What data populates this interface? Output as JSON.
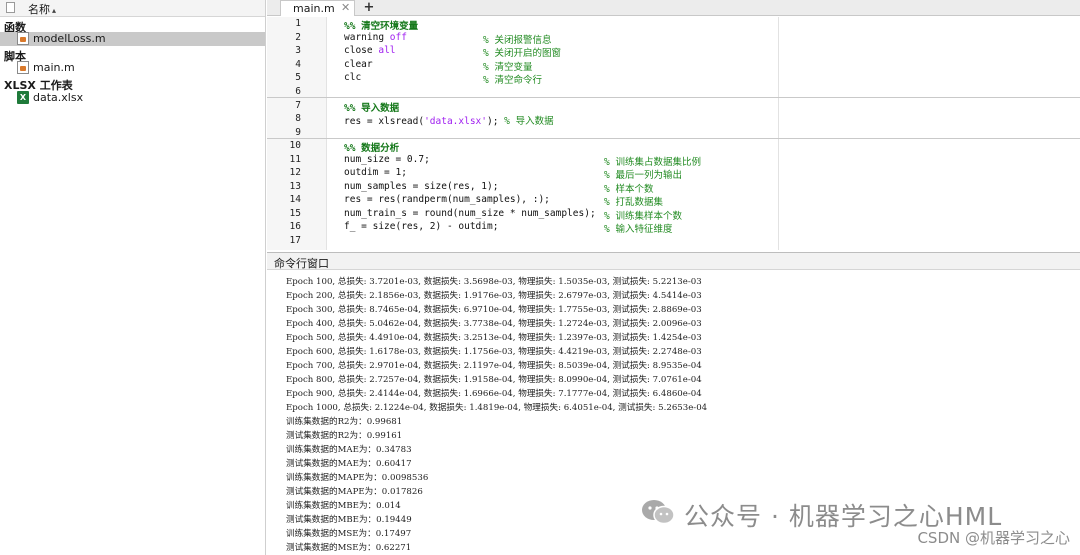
{
  "sidebar": {
    "column_header": "名称",
    "groups": {
      "functions": "函数",
      "scripts": "脚本",
      "xlsx": "XLSX 工作表"
    },
    "files": {
      "modelloss": "modelLoss.m",
      "main": "main.m",
      "data": "data.xlsx"
    }
  },
  "editor": {
    "tab_label": "main.m",
    "line_numbers": [
      "1",
      "2",
      "3",
      "4",
      "5",
      "6",
      "7",
      "8",
      "9",
      "10",
      "11",
      "12",
      "13",
      "14",
      "15",
      "16",
      "17"
    ],
    "code": {
      "l1_title": "%% 清空环境变量",
      "l2_cmd": "warning",
      "l2_kw": "off",
      "l2_cmt": "% 关闭报警信息",
      "l3_cmd": "close",
      "l3_kw": "all",
      "l3_cmt": "% 关闭开启的图窗",
      "l4_cmd": "clear",
      "l4_cmt": "% 清空变量",
      "l5_cmd": "clc",
      "l5_cmt": "% 清空命令行",
      "l7_title": "%% 导入数据",
      "l8_pre": "res = xlsread(",
      "l8_str": "'data.xlsx'",
      "l8_post": "); ",
      "l8_cmt": "% 导入数据",
      "l10_title": "%% 数据分析",
      "l11_code": "num_size = 0.7;",
      "l11_cmt": "% 训练集占数据集比例",
      "l12_code": "outdim = 1;",
      "l12_cmt": "% 最后一列为输出",
      "l13_code": "num_samples = size(res, 1);",
      "l13_cmt": "% 样本个数",
      "l14_code": "res = res(randperm(num_samples), :);",
      "l14_cmt": "% 打乱数据集",
      "l15_code": "num_train_s = round(num_size * num_samples);",
      "l15_cmt": "% 训练集样本个数",
      "l16_code": "f_ = size(res, 2) - outdim;",
      "l16_cmt": "% 输入特征维度"
    }
  },
  "command_window": {
    "title": "命令行窗口",
    "lines": [
      "Epoch 100, 总损失: 3.7201e-03, 数据损失: 3.5698e-03, 物理损失: 1.5035e-03, 测试损失: 5.2213e-03",
      "Epoch 200, 总损失: 2.1856e-03, 数据损失: 1.9176e-03, 物理损失: 2.6797e-03, 测试损失: 4.5414e-03",
      "Epoch 300, 总损失: 8.7465e-04, 数据损失: 6.9710e-04, 物理损失: 1.7755e-03, 测试损失: 2.8869e-03",
      "Epoch 400, 总损失: 5.0462e-04, 数据损失: 3.7738e-04, 物理损失: 1.2724e-03, 测试损失: 2.0096e-03",
      "Epoch 500, 总损失: 4.4910e-04, 数据损失: 3.2513e-04, 物理损失: 1.2397e-03, 测试损失: 1.4254e-03",
      "Epoch 600, 总损失: 1.6178e-03, 数据损失: 1.1756e-03, 物理损失: 4.4219e-03, 测试损失: 2.2748e-03",
      "Epoch 700, 总损失: 2.9701e-04, 数据损失: 2.1197e-04, 物理损失: 8.5039e-04, 测试损失: 8.9535e-04",
      "Epoch 800, 总损失: 2.7257e-04, 数据损失: 1.9158e-04, 物理损失: 8.0990e-04, 测试损失: 7.0761e-04",
      "Epoch 900, 总损失: 2.4144e-04, 数据损失: 1.6966e-04, 物理损失: 7.1777e-04, 测试损失: 6.4860e-04",
      "Epoch 1000, 总损失: 2.1224e-04, 数据损失: 1.4819e-04, 物理损失: 6.4051e-04, 测试损失: 5.2653e-04",
      "训练集数据的R2为：0.99681",
      "测试集数据的R2为：0.99161",
      "训练集数据的MAE为：0.34783",
      "测试集数据的MAE为：0.60417",
      "训练集数据的MAPE为：0.0098536",
      "测试集数据的MAPE为：0.017826",
      "训练集数据的MBE为：0.014",
      "测试集数据的MBE为：0.19449",
      "训练集数据的MSE为：0.17497",
      "测试集数据的MSE为：0.62271"
    ]
  },
  "watermark": {
    "account": "公众号 · 机器学习之心HML",
    "csdn": "CSDN @机器学习之心"
  },
  "icons": {
    "file": "m-file-icon",
    "excel": "xlsx-file-icon",
    "wechat": "wechat-icon"
  },
  "colors": {
    "cell_title": "#15781a",
    "comment": "#228b22",
    "keyword": "#a020f0",
    "selected_row": "#c9c9c9"
  }
}
